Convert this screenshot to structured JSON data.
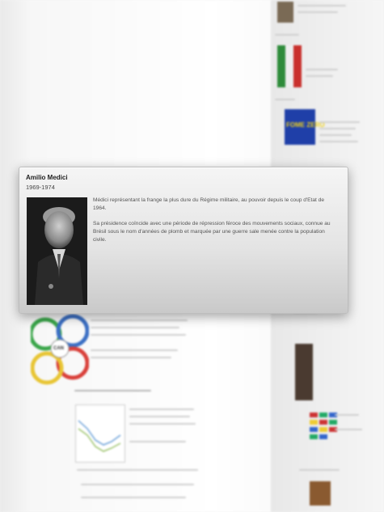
{
  "popup": {
    "name": "Amilio Medici",
    "dates": "1969-1974",
    "paragraphs": [
      "Médici représentant la frange la plus dure du Régime militaire, au pouvoir depuis le coup d'Etat de 1964.",
      "Sa présidence coïncide avec une période de répression féroce des mouvements sociaux, connue au Brésil sous le nom d'années de plomb et marquée par une guerre sale menée contre la population civile."
    ],
    "portrait_icon": "portrait-photo"
  },
  "background": {
    "logo_text": "CAN",
    "fome_zero_text": "FOME ZERO",
    "colors": {
      "logo_green": "#3aa64a",
      "logo_blue": "#3b6fc4",
      "logo_red": "#d9403a",
      "logo_yellow": "#e8c534",
      "fome_blue": "#1f3fa8",
      "fome_yellow": "#f1d21c",
      "fome_green": "#2e8f3c"
    }
  }
}
